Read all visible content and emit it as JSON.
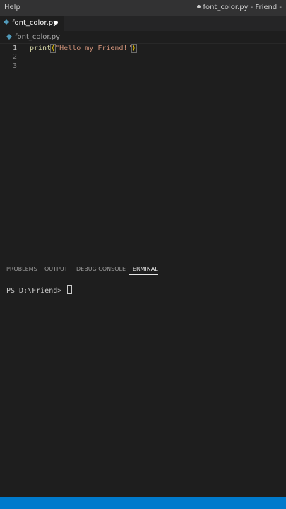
{
  "titlebar": {
    "menu_help": "Help",
    "window_title": "font_color.py - Friend -"
  },
  "tab": {
    "label": "font_color.py",
    "icon": "python-file-icon"
  },
  "breadcrumb": {
    "file": "font_color.py"
  },
  "editor": {
    "lines": [
      {
        "number": "1",
        "fn": "print",
        "open_paren": "(",
        "string": "\"Hello my Friend!\"",
        "close_paren": ")"
      },
      {
        "number": "2"
      },
      {
        "number": "3"
      }
    ]
  },
  "panel": {
    "tabs": [
      "PROBLEMS",
      "OUTPUT",
      "DEBUG CONSOLE",
      "TERMINAL"
    ],
    "active_tab": "TERMINAL"
  },
  "terminal": {
    "prompt": "PS D:\\Friend> "
  },
  "colors": {
    "statusbar": "#007acc",
    "function": "#dcdcaa",
    "string": "#ce9178",
    "bracket": "#ffd700"
  }
}
